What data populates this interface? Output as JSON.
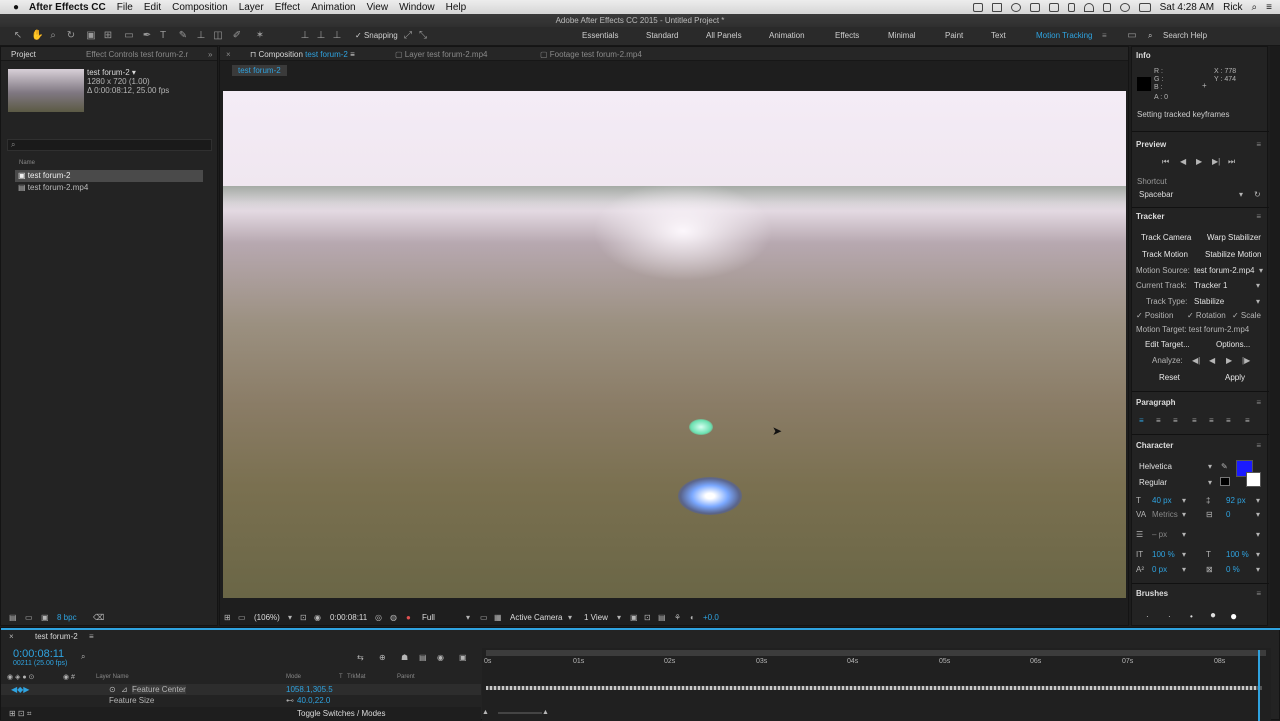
{
  "menubar": {
    "app": "After Effects CC",
    "items": [
      "File",
      "Edit",
      "Composition",
      "Layer",
      "Effect",
      "Animation",
      "View",
      "Window",
      "Help"
    ],
    "clock": "Sat 4:28 AM",
    "user": "Rick"
  },
  "window": {
    "title": "Adobe After Effects CC 2015 - Untitled Project *"
  },
  "toolbar": {
    "snapping": "Snapping",
    "workspaces": [
      "Essentials",
      "Standard",
      "All Panels",
      "Animation",
      "Effects",
      "Minimal",
      "Paint",
      "Text",
      "Motion Tracking"
    ],
    "search": "Search Help"
  },
  "project": {
    "tab": "Project",
    "tab2": "Effect Controls test forum-2.r",
    "comp_name": "test forum-2 ▾",
    "comp_dims": "1280 x 720 (1.00)",
    "comp_dur": "Δ 0:00:08:12, 25.00 fps",
    "col_name": "Name",
    "items": [
      "test forum-2",
      "test forum-2.mp4"
    ],
    "bpc": "8 bpc"
  },
  "viewer": {
    "tabs": [
      "Composition",
      "test forum-2",
      "Layer test forum-2.mp4",
      "Footage test forum-2.mp4"
    ],
    "crumb": "test forum-2",
    "zoom": "(106%)",
    "time": "0:00:08:11",
    "res": "Full",
    "camera": "Active Camera",
    "view": "1 View",
    "exposure": "+0.0"
  },
  "info": {
    "title": "Info",
    "r": "R :",
    "g": "G :",
    "b": "B :",
    "a": "A : 0",
    "x": "X : 778",
    "y": "Y : 474",
    "msg": "Setting tracked keyframes"
  },
  "preview": {
    "title": "Preview",
    "shortcut_label": "Shortcut",
    "shortcut": "Spacebar"
  },
  "tracker": {
    "title": "Tracker",
    "track_camera": "Track Camera",
    "warp": "Warp Stabilizer",
    "track_motion": "Track Motion",
    "stabilize": "Stabilize Motion",
    "source_label": "Motion Source:",
    "source": "test forum-2.mp4",
    "current_label": "Current Track:",
    "current": "Tracker 1",
    "type_label": "Track Type:",
    "type": "Stabilize",
    "position": "✓ Position",
    "rotation": "✓ Rotation",
    "scale": "✓ Scale",
    "target": "Motion Target: test forum-2.mp4",
    "edit_target": "Edit Target...",
    "options": "Options...",
    "analyze": "Analyze:",
    "reset": "Reset",
    "apply": "Apply"
  },
  "paragraph": {
    "title": "Paragraph"
  },
  "character": {
    "title": "Character",
    "font": "Helvetica",
    "style": "Regular",
    "size": "40 px",
    "leading": "92 px",
    "kerning": "Metrics",
    "tracking": "0",
    "stroke": "– px",
    "vscale": "100 %",
    "hscale": "100 %",
    "baseline": "0 px",
    "tsume": "0 %",
    "fill_color": "#1a1aff"
  },
  "brushes": {
    "title": "Brushes"
  },
  "timeline": {
    "tab": "test forum-2",
    "time": "0:00:08:11",
    "frames": "00211 (25.00 fps)",
    "col_layer": "Layer Name",
    "col_mode": "Mode",
    "col_t": "T",
    "col_trkmat": "TrkMat",
    "col_parent": "Parent",
    "rows": [
      {
        "name": "Feature Center",
        "value": "1058.1,305.5"
      },
      {
        "name": "Feature Size",
        "value": "40.0,22.0"
      }
    ],
    "toggle": "Toggle Switches / Modes",
    "ticks": [
      "0s",
      "01s",
      "02s",
      "03s",
      "04s",
      "05s",
      "06s",
      "07s",
      "08s"
    ]
  }
}
